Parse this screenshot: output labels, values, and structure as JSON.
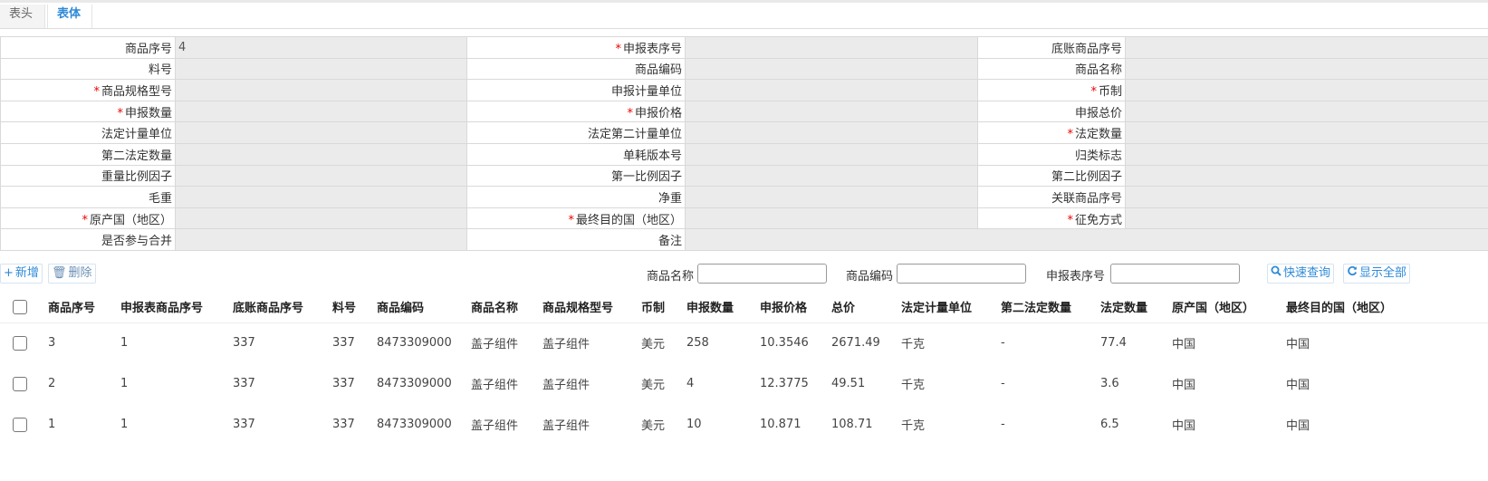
{
  "tabs": [
    "表头",
    "表体"
  ],
  "form": {
    "rows": [
      [
        {
          "label": "商品序号",
          "req": false,
          "value": "4"
        },
        {
          "label": "申报表序号",
          "req": true,
          "value": ""
        },
        {
          "label": "底账商品序号",
          "req": false,
          "value": ""
        }
      ],
      [
        {
          "label": "料号",
          "req": false,
          "value": ""
        },
        {
          "label": "商品编码",
          "req": false,
          "value": ""
        },
        {
          "label": "商品名称",
          "req": false,
          "value": ""
        }
      ],
      [
        {
          "label": "商品规格型号",
          "req": true,
          "value": ""
        },
        {
          "label": "申报计量单位",
          "req": false,
          "value": ""
        },
        {
          "label": "币制",
          "req": true,
          "value": ""
        }
      ],
      [
        {
          "label": "申报数量",
          "req": true,
          "value": ""
        },
        {
          "label": "申报价格",
          "req": true,
          "value": ""
        },
        {
          "label": "申报总价",
          "req": false,
          "value": ""
        }
      ],
      [
        {
          "label": "法定计量单位",
          "req": false,
          "value": ""
        },
        {
          "label": "法定第二计量单位",
          "req": false,
          "value": ""
        },
        {
          "label": "法定数量",
          "req": true,
          "value": ""
        }
      ],
      [
        {
          "label": "第二法定数量",
          "req": false,
          "value": ""
        },
        {
          "label": "单耗版本号",
          "req": false,
          "value": ""
        },
        {
          "label": "归类标志",
          "req": false,
          "value": ""
        }
      ],
      [
        {
          "label": "重量比例因子",
          "req": false,
          "value": ""
        },
        {
          "label": "第一比例因子",
          "req": false,
          "value": ""
        },
        {
          "label": "第二比例因子",
          "req": false,
          "value": ""
        }
      ],
      [
        {
          "label": "毛重",
          "req": false,
          "value": ""
        },
        {
          "label": "净重",
          "req": false,
          "value": ""
        },
        {
          "label": "关联商品序号",
          "req": false,
          "value": ""
        }
      ],
      [
        {
          "label": "原产国（地区）",
          "req": true,
          "value": ""
        },
        {
          "label": "最终目的国（地区）",
          "req": true,
          "value": ""
        },
        {
          "label": "征免方式",
          "req": true,
          "value": ""
        }
      ],
      [
        {
          "label": "是否参与合并",
          "req": false,
          "value": ""
        },
        {
          "label": "备注",
          "req": false,
          "value": ""
        }
      ]
    ]
  },
  "toolbar": {
    "add_label": "新增",
    "delete_label": "删除",
    "filter_name_label": "商品名称",
    "filter_code_label": "商品编码",
    "filter_seq_label": "申报表序号",
    "filter_name_value": "",
    "filter_code_value": "",
    "filter_seq_value": "",
    "quick_query_label": "快速查询",
    "show_all_label": "显示全部"
  },
  "grid": {
    "headers": [
      "商品序号",
      "申报表商品序号",
      "底账商品序号",
      "料号",
      "商品编码",
      "商品名称",
      "商品规格型号",
      "币制",
      "申报数量",
      "申报价格",
      "总价",
      "法定计量单位",
      "第二法定数量",
      "法定数量",
      "原产国（地区）",
      "最终目的国（地区）"
    ],
    "rows": [
      [
        "3",
        "1",
        "337",
        "337",
        "8473309000",
        "盖子组件",
        "盖子组件",
        "美元",
        "258",
        "10.3546",
        "2671.49",
        "千克",
        "-",
        "77.4",
        "中国",
        "中国"
      ],
      [
        "2",
        "1",
        "337",
        "337",
        "8473309000",
        "盖子组件",
        "盖子组件",
        "美元",
        "4",
        "12.3775",
        "49.51",
        "千克",
        "-",
        "3.6",
        "中国",
        "中国"
      ],
      [
        "1",
        "1",
        "337",
        "337",
        "8473309000",
        "盖子组件",
        "盖子组件",
        "美元",
        "10",
        "10.871",
        "108.71",
        "千克",
        "-",
        "6.5",
        "中国",
        "中国"
      ]
    ]
  }
}
